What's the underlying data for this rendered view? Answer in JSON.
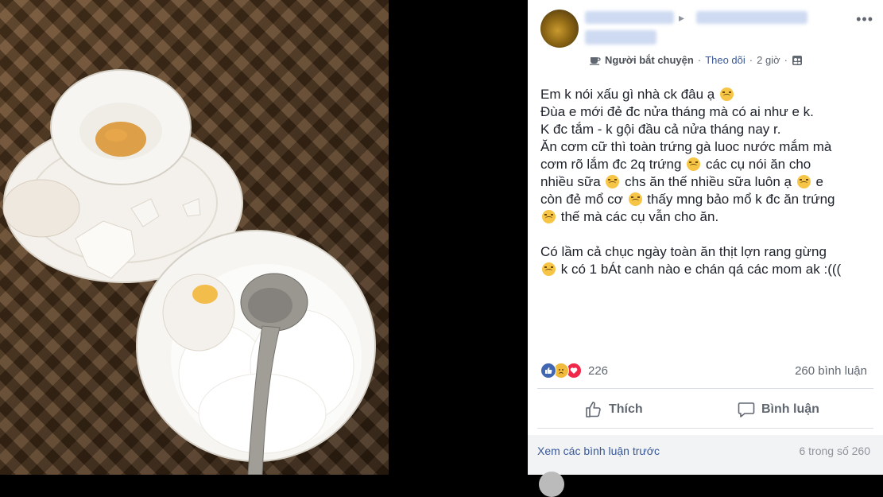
{
  "post": {
    "group_label": "Người bắt chuyện",
    "follow_label": "Theo dõi",
    "separator": "·",
    "time": "2 giờ",
    "text_lines": [
      "Em k nói xấu gì nhà ck đâu ạ",
      "Đùa e mới đẻ đc nửa tháng mà có ai như e k.",
      "K đc tắm - k gội đầu cả nửa tháng nay r.",
      "Ăn cơm cữ thì toàn trứng gà luoc nước mắm mà",
      "cơm rõ lắm đc 2q trứng",
      "các cụ nói ăn cho",
      "nhiều sữa",
      "chs ăn thế nhiều sữa luôn ạ",
      "e",
      "còn đẻ mổ cơ",
      "thấy mng bảo mổ k đc ăn trứng",
      "thế mà các cụ vẫn cho ăn.",
      "Có lầm cả chục ngày toàn ăn thịt lợn rang gừng",
      "k có 1 bÁt canh nào e chán qá các mom ak :((("
    ]
  },
  "reactions": {
    "count": "226",
    "comments": "260 bình luận"
  },
  "actions": {
    "like": "Thích",
    "comment": "Bình luận"
  },
  "comments": {
    "view_previous": "Xem các bình luận trước",
    "count_of": "6 trong số 260"
  }
}
